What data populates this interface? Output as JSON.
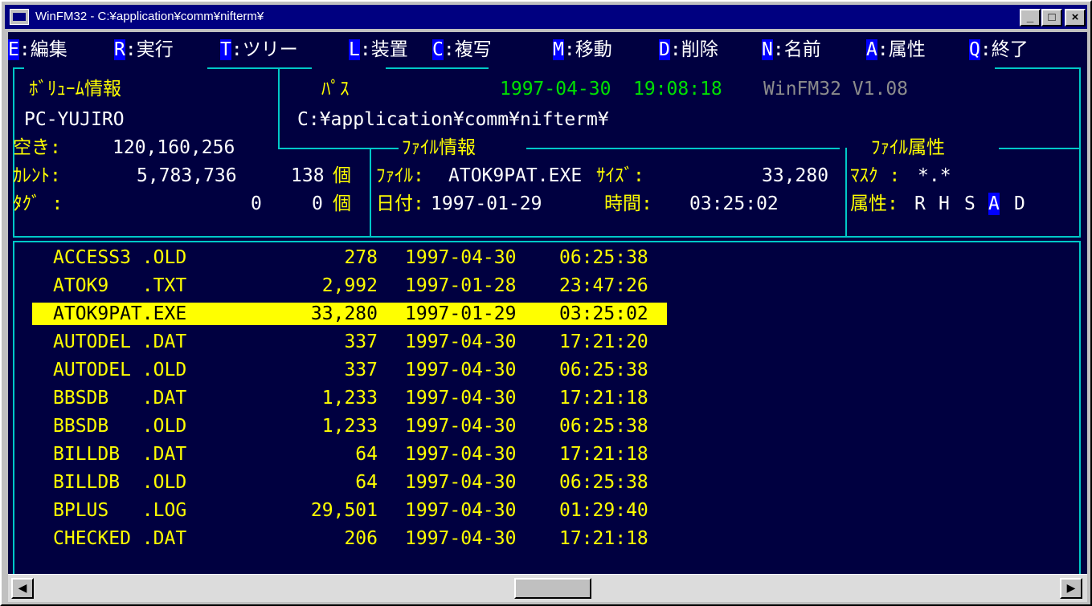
{
  "window": {
    "title": "WinFM32 - C:¥application¥comm¥nifterm¥"
  },
  "titlebar_buttons": {
    "minimize": "_",
    "maximize": "□",
    "close": "×"
  },
  "menu": [
    {
      "key": "E",
      "label": ":編集"
    },
    {
      "key": "R",
      "label": ":実行"
    },
    {
      "key": "T",
      "label": ":ツリー"
    },
    {
      "key": "L",
      "label": ":装置"
    },
    {
      "key": "C",
      "label": ":複写"
    },
    {
      "key": "M",
      "label": ":移動"
    },
    {
      "key": "D",
      "label": ":削除"
    },
    {
      "key": "N",
      "label": ":名前"
    },
    {
      "key": "A",
      "label": ":属性"
    },
    {
      "key": "Q",
      "label": ":終了"
    }
  ],
  "volume": {
    "header": "ﾎﾞﾘｭｰﾑ情報",
    "name": "PC-YUJIRO",
    "free_label": "空き:",
    "free_value": "120,160,256",
    "current_label": "ｶﾚﾝﾄ:",
    "current_size": "5,783,736",
    "current_count": "138",
    "count_unit": "個",
    "tag_label": "ﾀｸﾞ :",
    "tag_size": "0",
    "tag_count": "0"
  },
  "path": {
    "header": "ﾊﾟｽ",
    "value": "C:¥application¥comm¥nifterm¥"
  },
  "datetime": {
    "date": "1997-04-30",
    "time": "19:08:18"
  },
  "version": "WinFM32 V1.08",
  "file_info": {
    "header": "ﾌｧｲﾙ情報",
    "file_label": "ﾌｧｲﾙ:",
    "file_name": "ATOK9PAT.EXE",
    "size_label": "ｻｲｽﾞ:",
    "size_value": "33,280",
    "date_label": "日付:",
    "date_value": "1997-01-29",
    "time_label": "時間:",
    "time_value": "03:25:02"
  },
  "file_attr": {
    "header": "ﾌｧｲﾙ属性",
    "mask_label": "ﾏｽｸ :",
    "mask_value": "*.*",
    "attr_label": "属性:",
    "attr_r": "R",
    "attr_h": "H",
    "attr_s": "S",
    "attr_a": "A",
    "attr_d": "D"
  },
  "files": [
    {
      "name": "ACCESS3 .OLD",
      "size": "278",
      "date": "1997-04-30",
      "time": "06:25:38"
    },
    {
      "name": "ATOK9   .TXT",
      "size": "2,992",
      "date": "1997-01-28",
      "time": "23:47:26"
    },
    {
      "name": "ATOK9PAT.EXE",
      "size": "33,280",
      "date": "1997-01-29",
      "time": "03:25:02"
    },
    {
      "name": "AUTODEL .DAT",
      "size": "337",
      "date": "1997-04-30",
      "time": "17:21:20"
    },
    {
      "name": "AUTODEL .OLD",
      "size": "337",
      "date": "1997-04-30",
      "time": "06:25:38"
    },
    {
      "name": "BBSDB   .DAT",
      "size": "1,233",
      "date": "1997-04-30",
      "time": "17:21:18"
    },
    {
      "name": "BBSDB   .OLD",
      "size": "1,233",
      "date": "1997-04-30",
      "time": "06:25:38"
    },
    {
      "name": "BILLDB  .DAT",
      "size": "64",
      "date": "1997-04-30",
      "time": "17:21:18"
    },
    {
      "name": "BILLDB  .OLD",
      "size": "64",
      "date": "1997-04-30",
      "time": "06:25:38"
    },
    {
      "name": "BPLUS   .LOG",
      "size": "29,501",
      "date": "1997-04-30",
      "time": "01:29:40"
    },
    {
      "name": "CHECKED .DAT",
      "size": "206",
      "date": "1997-04-30",
      "time": "17:21:18"
    }
  ],
  "selected_row": 2,
  "scrollbar": {
    "left_arrow": "◀",
    "right_arrow": "▶"
  },
  "colors": {
    "background": "#000040",
    "selection": "#ffff00",
    "border": "#00c8c8",
    "key_highlight": "#0000ff"
  }
}
